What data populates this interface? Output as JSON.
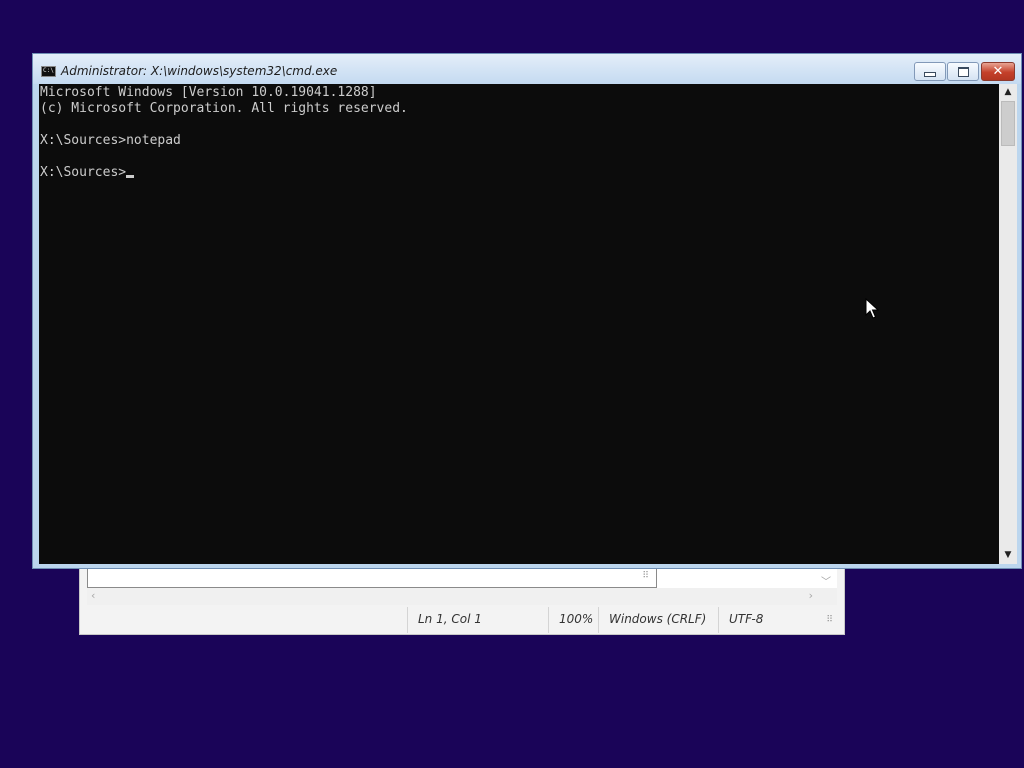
{
  "notepad": {
    "status": {
      "position": "Ln 1, Col 1",
      "zoom": "100%",
      "line_ending": "Windows (CRLF)",
      "encoding": "UTF-8"
    }
  },
  "cmd": {
    "title": "Administrator: X:\\windows\\system32\\cmd.exe",
    "icon_text": "C:\\",
    "console_lines": [
      "Microsoft Windows [Version 10.0.19041.1288]",
      "(c) Microsoft Corporation. All rights reserved.",
      "",
      "X:\\Sources>notepad",
      ""
    ],
    "prompt": "X:\\Sources>"
  },
  "colors": {
    "desktop": "#1a0458",
    "console_bg": "#0c0c0c",
    "console_fg": "#cccccc"
  },
  "icons": {
    "minimize": "minimize-icon",
    "maximize": "maximize-icon",
    "close": "close-icon",
    "scroll_up": "chevron-up-icon",
    "scroll_down": "chevron-down-icon"
  }
}
